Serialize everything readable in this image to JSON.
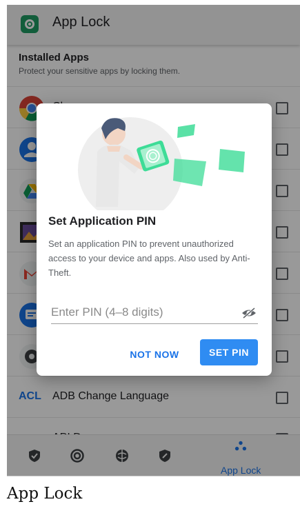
{
  "appbar": {
    "title": "App Lock",
    "logo_icon": "app-lock-logo-icon"
  },
  "list": {
    "header_title": "Installed Apps",
    "header_subtitle": "Protect your sensitive apps by locking them.",
    "items": [
      {
        "name": "Chrome",
        "icon": "chrome-icon"
      },
      {
        "name": "",
        "icon": "contacts-icon"
      },
      {
        "name": "",
        "icon": "drive-icon"
      },
      {
        "name": "",
        "icon": "gallery-icon"
      },
      {
        "name": "",
        "icon": "gmail-icon"
      },
      {
        "name": "",
        "icon": "messages-icon"
      },
      {
        "name": "",
        "icon": "settings-icon"
      },
      {
        "name": "ADB Change Language",
        "icon_text": "ACL"
      },
      {
        "name": "API Demos",
        "icon": "folder-icon"
      }
    ]
  },
  "dialog": {
    "title": "Set Application PIN",
    "body": "Set an application PIN to prevent unauthorized access to your device and apps. Also used by Anti-Theft.",
    "pin_placeholder": "Enter PIN (4–8 digits)",
    "pin_value": "",
    "not_now_label": "NOT NOW",
    "set_pin_label": "SET PIN"
  },
  "bottom_nav": {
    "items": [
      {
        "icon": "shield-icon"
      },
      {
        "icon": "privacy-icon"
      },
      {
        "icon": "browsing-icon"
      },
      {
        "icon": "tag-shield-icon"
      },
      {
        "icon": "app-lock-nav-icon",
        "label": "App Lock",
        "active": true
      }
    ]
  },
  "caption": "App Lock",
  "colors": {
    "accent": "#1a73e8",
    "button": "#2f8cf2",
    "brand_green": "#1e9b63",
    "illustration_green": "#3ddc97"
  }
}
